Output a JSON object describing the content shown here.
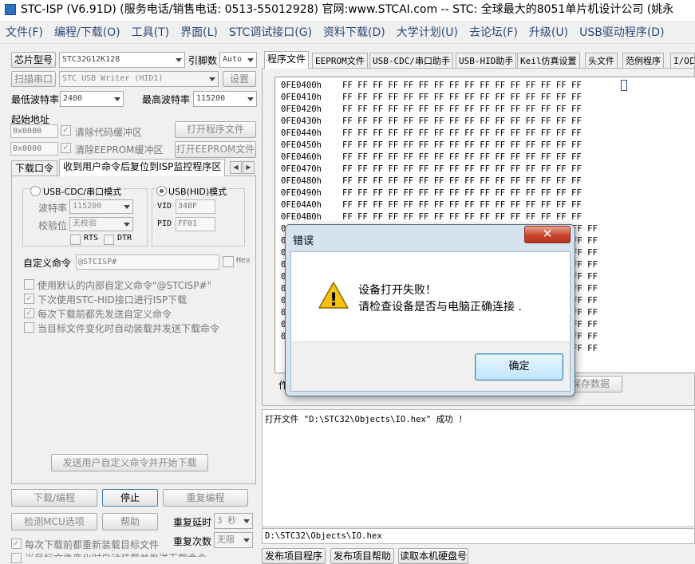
{
  "window": {
    "title": "STC-ISP (V6.91D) (服务电话/销售电话: 0513-55012928) 官网:www.STCAI.com  -- STC: 全球最大的8051单片机设计公司 (姚永"
  },
  "menu": [
    "文件(F)",
    "编程/下载(O)",
    "工具(T)",
    "界面(L)",
    "STC调试接口(G)",
    "资料下载(D)",
    "大学计划(U)",
    "去论坛(F)",
    "升级(U)",
    "USB驱动程序(D)"
  ],
  "left": {
    "chip_button": "芯片型号",
    "chip_value": "STC32G12K128",
    "pins_label": "引脚数",
    "pins_value": "Auto",
    "scan_button": "扫描串口",
    "port_value": "STC USB Writer (HID1)",
    "settings_button": "设置",
    "min_baud_label": "最低波特率",
    "min_baud_value": "2400",
    "max_baud_label": "最高波特率",
    "max_baud_value": "115200",
    "start_addr_label": "起始地址",
    "addr1_value": "0x0000",
    "clear_code_label": "清除代码缓冲区",
    "open_prog_button": "打开程序文件",
    "addr2_value": "0x0000",
    "clear_eeprom_label": "清除EEPROM缓冲区",
    "open_eeprom_button": "打开EEPROM文件",
    "tabs": [
      "下载口令",
      "收到用户命令后复位到ISP监控程序区"
    ],
    "mode_cdc": "USB-CDC/串口模式",
    "mode_hid": "USB(HID)模式",
    "baud_label": "波特率",
    "baud_value": "115200",
    "parity_label": "校验位",
    "parity_value": "无校验",
    "rts_label": "RTS",
    "dtr_label": "DTR",
    "vid_label": "VID",
    "vid_value": "34BF",
    "pid_label": "PID",
    "pid_value": "FF01",
    "custom_cmd_label": "自定义命令",
    "custom_cmd_value": "@STCISP#",
    "hex_label": "Hex",
    "opt1": "使用默认的内部自定义命令\"@STCISP#\"",
    "opt2": "下次使用STC-HID接口进行ISP下载",
    "opt3": "每次下载前都先发送自定义命令",
    "opt4": "当目标文件变化时自动装载并发送下载命令",
    "send_cmd_button": "发送用户自定义命令并开始下载",
    "download_button": "下载/编程",
    "stop_button": "停止",
    "reprogram_button": "重复编程",
    "detect_button": "检测MCU选项",
    "help_button": "帮助",
    "repeat_delay_label": "重复延时",
    "repeat_delay_value": "3 秒",
    "repeat_count_label": "重复次数",
    "repeat_count_value": "无限",
    "reload_label": "每次下载前都重新装载目标文件",
    "autoload_label": "当目标文件变化时自动装载并发送下载命令"
  },
  "right": {
    "tabs": [
      "程序文件",
      "EEPROM文件",
      "USB-CDC/串口助手",
      "USB-HID助手",
      "Keil仿真设置",
      "头文件",
      "范例程序",
      "I/O口"
    ],
    "hex_rows": [
      {
        "addr": "0FE0400h",
        "bytes": "FF FF FF FF FF FF FF FF FF FF FF FF FF FF FF FF"
      },
      {
        "addr": "0FE0410h",
        "bytes": "FF FF FF FF FF FF FF FF FF FF FF FF FF FF FF FF"
      },
      {
        "addr": "0FE0420h",
        "bytes": "FF FF FF FF FF FF FF FF FF FF FF FF FF FF FF FF"
      },
      {
        "addr": "0FE0430h",
        "bytes": "FF FF FF FF FF FF FF FF FF FF FF FF FF FF FF FF"
      },
      {
        "addr": "0FE0440h",
        "bytes": "FF FF FF FF FF FF FF FF FF FF FF FF FF FF FF FF"
      },
      {
        "addr": "0FE0450h",
        "bytes": "FF FF FF FF FF FF FF FF FF FF FF FF FF FF FF FF"
      },
      {
        "addr": "0FE0460h",
        "bytes": "FF FF FF FF FF FF FF FF FF FF FF FF FF FF FF FF"
      },
      {
        "addr": "0FE0470h",
        "bytes": "FF FF FF FF FF FF FF FF FF FF FF FF FF FF FF FF"
      },
      {
        "addr": "0FE0480h",
        "bytes": "FF FF FF FF FF FF FF FF FF FF FF FF FF FF FF FF"
      },
      {
        "addr": "0FE0490h",
        "bytes": "FF FF FF FF FF FF FF FF FF FF FF FF FF FF FF FF"
      },
      {
        "addr": "0FE04A0h",
        "bytes": "FF FF FF FF FF FF FF FF FF FF FF FF FF FF FF FF"
      },
      {
        "addr": "0FE04B0h",
        "bytes": "FF FF FF FF FF FF FF FF FF FF FF FF FF FF FF FF"
      },
      {
        "addr": "0",
        "bytes": "FF FF"
      },
      {
        "addr": "0",
        "bytes": "FF FF"
      },
      {
        "addr": "0",
        "bytes": "FF FF"
      },
      {
        "addr": "0",
        "bytes": "FF FF"
      },
      {
        "addr": "0",
        "bytes": "FF FF"
      },
      {
        "addr": "0",
        "bytes": "FF FF"
      },
      {
        "addr": "0",
        "bytes": "FF FF"
      },
      {
        "addr": "0",
        "bytes": "FF FF"
      },
      {
        "addr": "0",
        "bytes": "FF FF"
      },
      {
        "addr": "0",
        "bytes": "FF FF"
      },
      {
        "addr": "",
        "bytes": "FF FF"
      }
    ],
    "bottom_partial_label": "作",
    "save_data_button": "保存数据",
    "log_line": "打开文件 \"D:\\STC32\\Objects\\IO.hex\" 成功 !",
    "path": "D:\\STC32\\Objects\\IO.hex",
    "bottom_buttons": [
      "发布项目程序",
      "发布项目帮助",
      "读取本机硬盘号"
    ]
  },
  "dialog": {
    "title": "错误",
    "line1": "设备打开失败！",
    "line2": "请检查设备是否与电脑正确连接 .",
    "ok_button": "确定",
    "close_glyph": "✕",
    "warning_glyph": "!"
  },
  "colors": {
    "menu_text": "#2b4a7a",
    "dialog_frame": "#d5e3f1",
    "close_red": "#c8452c",
    "warning_yellow": "#f5c211"
  }
}
